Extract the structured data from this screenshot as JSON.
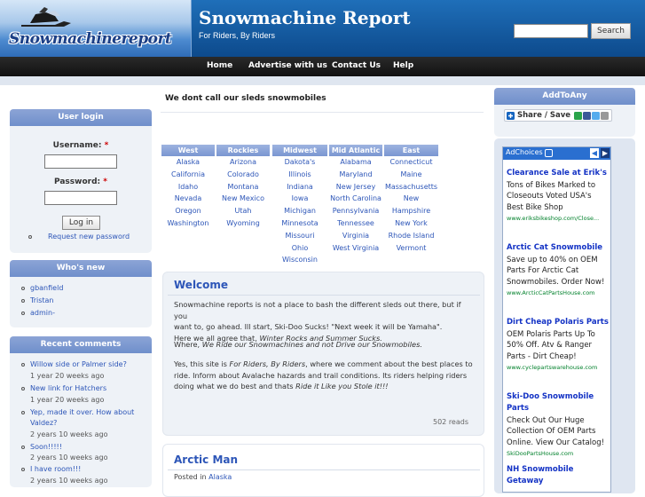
{
  "header": {
    "logo_text": "Snowmachinereport",
    "site_name": "Snowmachine Report",
    "slogan": "For Riders, By Riders",
    "search_button": "Search"
  },
  "nav": [
    "Home",
    "Advertise with us",
    "Contact Us",
    "Help"
  ],
  "page_title": "We dont call our sleds snowmobiles",
  "login": {
    "title": "User login",
    "username_label": "Username:",
    "password_label": "Password:",
    "required_mark": "*",
    "login_button": "Log in",
    "request_password": "Request new password"
  },
  "whos_new": {
    "title": "Who's new",
    "users": [
      "gbanfield",
      "Tristan",
      "admin-"
    ]
  },
  "recent_comments": {
    "title": "Recent comments",
    "items": [
      {
        "text": "Willow side or Palmer side?",
        "meta": "1 year 20 weeks ago"
      },
      {
        "text": "New link for Hatchers",
        "meta": "1 year 20 weeks ago"
      },
      {
        "text": "Yep, made it over. How about",
        "text2": "Valdez?",
        "meta": "2 years 10 weeks ago"
      },
      {
        "text": "Soon!!!!!",
        "meta": "2 years 10 weeks ago"
      },
      {
        "text": "I have room!!!",
        "meta": "2 years 10 weeks ago"
      }
    ]
  },
  "regions": [
    {
      "name": "West",
      "states": [
        "Alaska",
        "California",
        "Idaho",
        "Nevada",
        "Oregon",
        "Washington"
      ]
    },
    {
      "name": "Rockies",
      "states": [
        "Arizona",
        "Colorado",
        "Montana",
        "New Mexico",
        "Utah",
        "Wyoming"
      ]
    },
    {
      "name": "Midwest",
      "states": [
        "Dakota's",
        "Illinois",
        "Indiana",
        "Iowa",
        "Michigan",
        "Minnesota",
        "Missouri",
        "Ohio",
        "Wisconsin"
      ]
    },
    {
      "name": "Mid Atlantic",
      "states": [
        "Alabama",
        "Maryland",
        "New Jersey",
        "North Carolina",
        "Pennsylvania",
        "Tennessee",
        "Virginia",
        "West Virginia"
      ]
    },
    {
      "name": "East",
      "states": [
        "Connecticut",
        "Maine",
        "Massachusetts",
        "New",
        "Hampshire",
        "New York",
        "Rhode Island",
        "Vermont"
      ]
    }
  ],
  "welcome": {
    "title": "Welcome",
    "p1_line1": "Snowmachine reports is not a place to bash the different sleds out there, but if you",
    "p1_line2": "want to, go ahead. Ill start, Ski-Doo Sucks! \"Next week it will be Yamaha\".",
    "p1_line3a": "Here we all agree that, ",
    "p1_line3b": "Winter Rocks and Summer Sucks.",
    "p2a": "Where, ",
    "p2b": "We Ride our Snowmachines and not Drive our Snowmobiles.",
    "p3_line1a": "Yes, this site is ",
    "p3_line1b": "For Riders, By Riders",
    "p3_line1c": ", where we comment about the best places to",
    "p3_line2": "ride. Inform about Avalache hazards and trail conditions. Its riders helping riders",
    "p3_line3a": "doing what we do best and thats ",
    "p3_line3b": "Ride it Like you Stole it!!!",
    "reads": "502 reads"
  },
  "arctic": {
    "title": "Arctic Man",
    "posted_in": "Posted in",
    "category": "Alaska"
  },
  "addtoany": {
    "title": "AddToAny",
    "share_label": "Share / Save"
  },
  "ads": {
    "choices": "AdChoices",
    "items": [
      {
        "title": "Clearance Sale at Erik's",
        "lines": [
          "Tons of Bikes Marked to",
          "Closeouts Voted USA's",
          "Best Bike Shop"
        ],
        "url": "www.eriksbikeshop.com/Close..."
      },
      {
        "title": "Arctic Cat Snowmobile",
        "lines": [
          "Save up to 40% on OEM",
          "Parts For Arctic Cat",
          "Snowmobiles. Order Now!"
        ],
        "url": "www.ArcticCatPartsHouse.com"
      },
      {
        "title": "Dirt Cheap Polaris Parts",
        "lines": [
          "OEM Polaris Parts Up To",
          "50% Off. Atv & Ranger",
          "Parts - Dirt Cheap!"
        ],
        "url": "www.cyclepartswarehouse.com"
      },
      {
        "title": "Ski-Doo Snowmobile",
        "title2": "Parts",
        "lines": [
          "Check Out Our Huge",
          "Collection Of OEM Parts",
          "Online. View Our Catalog!"
        ],
        "url": "SkiDooPartsHouse.com"
      },
      {
        "title": "NH Snowmobile",
        "title2": "Getaway",
        "lines": [],
        "url": ""
      }
    ]
  },
  "colors": {
    "header_blue": "#1f6fb9",
    "nav_black": "#111111",
    "block_title": "#7a96d1",
    "link": "#2d56b8",
    "ad_title": "#1433c5",
    "ad_url": "#00802b"
  }
}
